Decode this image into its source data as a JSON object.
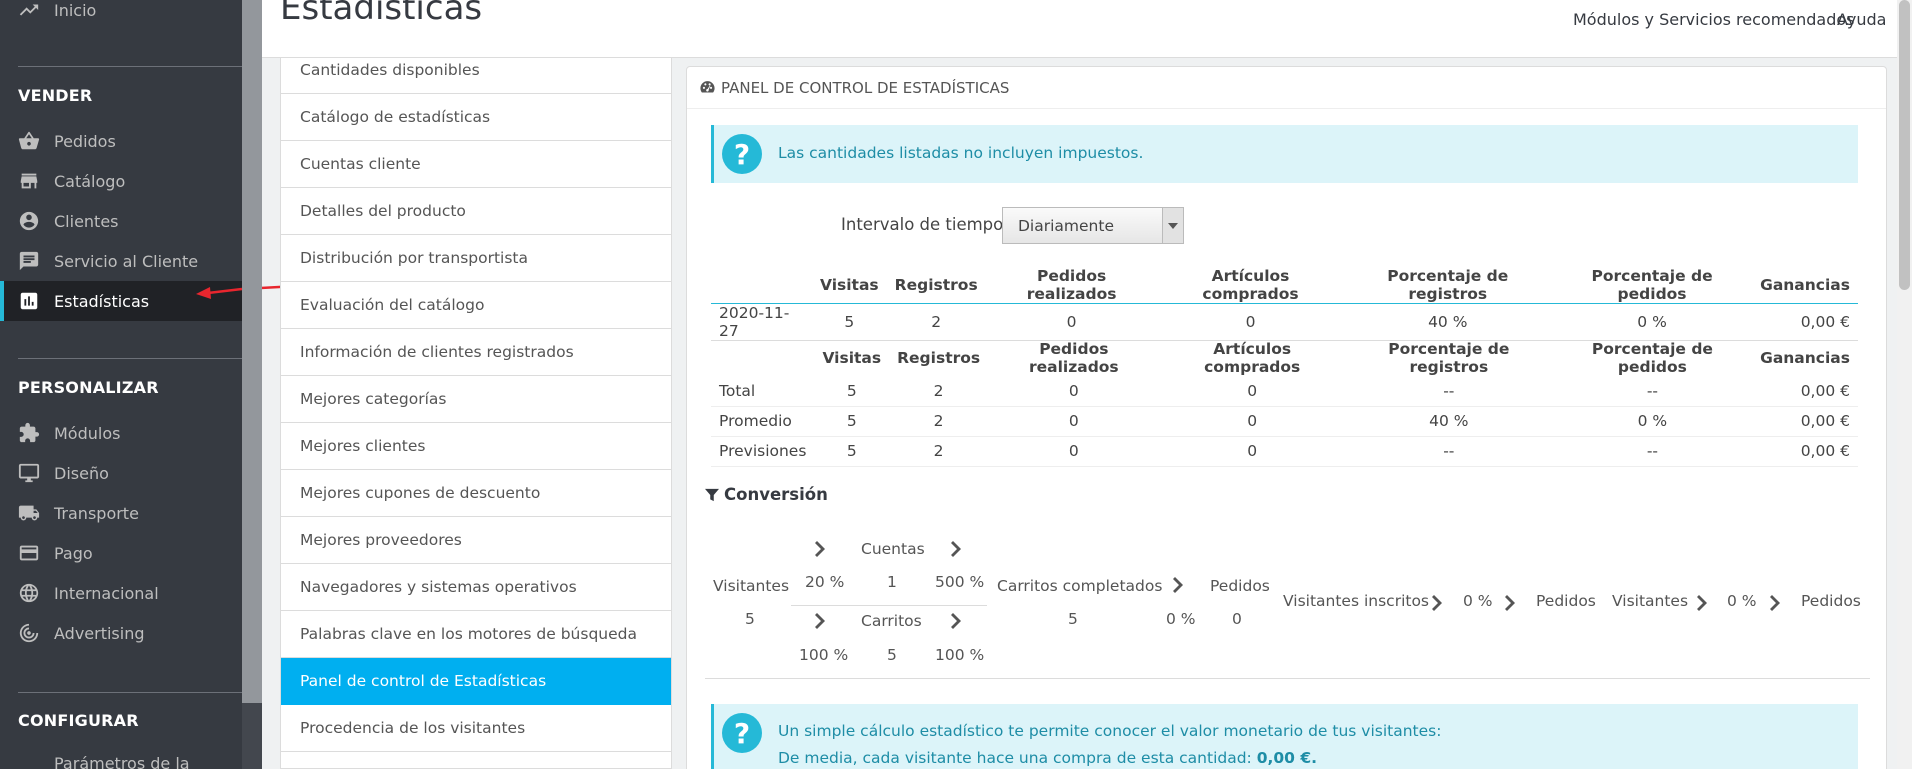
{
  "sidebar": {
    "top_item": "Inicio",
    "sections": [
      "VENDER",
      "PERSONALIZAR",
      "CONFIGURAR"
    ],
    "vender_items": [
      "Pedidos",
      "Catálogo",
      "Clientes",
      "Servicio al Cliente",
      "Estadísticas"
    ],
    "personalizar_items": [
      "Módulos",
      "Diseño",
      "Transporte",
      "Pago",
      "Internacional",
      "Advertising"
    ],
    "configurar_items": [
      "Parámetros de la"
    ],
    "active_item": "Estadísticas"
  },
  "header": {
    "title": "Estadísticas",
    "link_modules": "Módulos y Servicios recomendados",
    "link_help": "Ayuda"
  },
  "stats_list": {
    "items": [
      "Cantidades disponibles",
      "Catálogo de estadísticas",
      "Cuentas cliente",
      "Detalles del producto",
      "Distribución por transportista",
      "Evaluación del catálogo",
      "Información de clientes registrados",
      "Mejores categorías",
      "Mejores clientes",
      "Mejores cupones de descuento",
      "Mejores proveedores",
      "Navegadores y sistemas operativos",
      "Palabras clave en los motores de búsqueda",
      "Panel de control de Estadísticas",
      "Procedencia de los visitantes"
    ],
    "active_item": "Panel de control de Estadísticas"
  },
  "panel": {
    "title": "PANEL DE CONTROL DE ESTADÍSTICAS",
    "alert_tax": "Las cantidades listadas no incluyen impuestos.",
    "interval_label": "Intervalo de tiempo",
    "interval_value": "Diariamente",
    "headers": [
      "Visitas",
      "Registros",
      "Pedidos realizados",
      "Artículos comprados",
      "Porcentaje de registros",
      "Porcentaje de pedidos",
      "Ganancias"
    ],
    "daily_rows": [
      [
        "2020-11-27",
        "5",
        "2",
        "0",
        "0",
        "40 %",
        "0 %",
        "0,00 €"
      ]
    ],
    "summary_rows": [
      [
        "Total",
        "5",
        "2",
        "0",
        "0",
        "--",
        "--",
        "0,00 €"
      ],
      [
        "Promedio",
        "5",
        "2",
        "0",
        "0",
        "40 %",
        "0 %",
        "0,00 €"
      ],
      [
        "Previsiones",
        "5",
        "2",
        "0",
        "0",
        "--",
        "--",
        "0,00 €"
      ]
    ],
    "conversion": {
      "title": "Conversión",
      "visitantes_label": "Visitantes",
      "visitantes_value": "5",
      "rate_cuentas": "20 %",
      "cuentas_label": "Cuentas",
      "cuentas_value": "1",
      "rate_cuentas_out": "500 %",
      "rate_carritos": "100 %",
      "carritos_label": "Carritos",
      "carritos_value": "5",
      "rate_carritos_out": "100 %",
      "completed_label": "Carritos completados",
      "completed_value": "5",
      "rate_pedidos": "0 %",
      "pedidos_label": "Pedidos",
      "pedidos_value": "0",
      "inscritos_label": "Visitantes inscritos",
      "inscritos_rate": "0 %",
      "inscritos_pedidos": "Pedidos",
      "visitantes2_label": "Visitantes",
      "visitantes2_rate": "0 %",
      "visitantes2_pedidos": "Pedidos"
    },
    "alert_calc_line1": "Un simple cálculo estadístico te permite conocer el valor monetario de tus visitantes:",
    "alert_calc_line2_prefix": "De media, cada visitante hace una compra de esta cantidad: ",
    "alert_calc_value": "0,00 €."
  }
}
